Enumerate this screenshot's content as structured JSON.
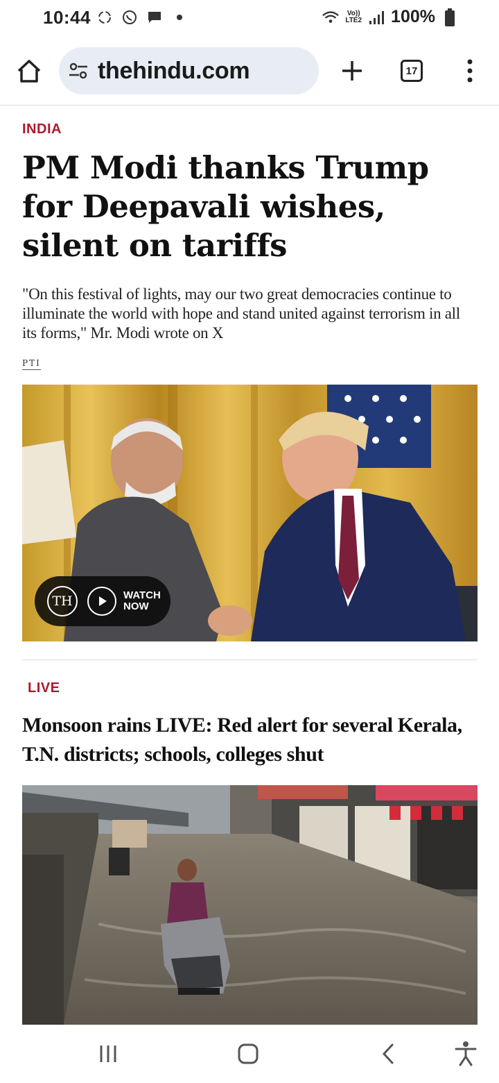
{
  "status_bar": {
    "time": "10:44",
    "battery": "100%",
    "network_top": "Vo))",
    "network_bottom": "LTE2"
  },
  "browser": {
    "url": "thehindu.com",
    "tab_count": "17"
  },
  "article1": {
    "section": "INDIA",
    "headline": "PM Modi thanks Trump for Deepavali wishes, silent on tariffs",
    "summary": "\"On this festival of lights, may our two great democracies continue to illuminate the world with hope and stand united against terrorism in all its forms,\" Mr. Modi wrote on X",
    "byline": "PTI",
    "video_badge": {
      "logo": "TH",
      "label_line1": "WATCH",
      "label_line2": "NOW"
    }
  },
  "article2": {
    "section": "LIVE",
    "headline": "Monsoon rains LIVE: Red alert for several Kerala, T.N. districts; schools, colleges shut"
  },
  "colors": {
    "accent": "#b0182d",
    "url_bar": "#e8edf5"
  },
  "icons": {
    "home": "home-icon",
    "tune": "tune-icon",
    "new_tab": "plus-icon",
    "menu": "more-vert-icon",
    "recents": "recents-icon",
    "home_nav": "home-nav-icon",
    "back": "back-icon",
    "accessibility": "accessibility-icon"
  }
}
